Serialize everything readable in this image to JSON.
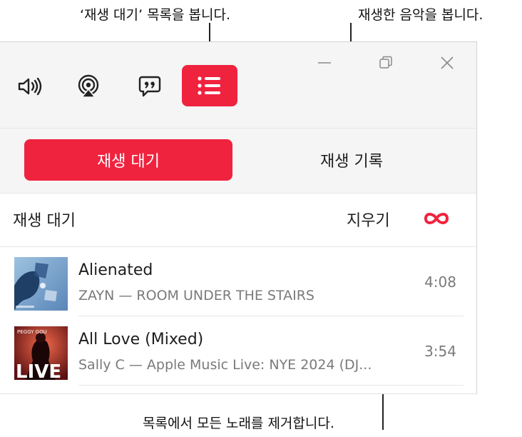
{
  "callouts": {
    "queue": "‘재생 대기’ 목록을 봅니다.",
    "history": "재생한 음악을 봅니다.",
    "clear": "목록에서 모든 노래를 제거합니다."
  },
  "toolbar": {
    "icons": [
      "volume-icon",
      "airplay-icon",
      "lyrics-icon",
      "queue-list-icon"
    ],
    "active_color": "#f0233f",
    "window_controls": [
      "minimize-icon",
      "restore-icon",
      "close-icon"
    ]
  },
  "tabs": {
    "queue_label": "재생 대기",
    "history_label": "재생 기록"
  },
  "list_header": {
    "title": "재생 대기",
    "clear_label": "지우기",
    "autoplay_icon": "infinity-icon"
  },
  "tracks": [
    {
      "title": "Alienated",
      "subtitle": "ZAYN — ROOM UNDER THE STAIRS",
      "duration": "4:08"
    },
    {
      "title": "All Love (Mixed)",
      "subtitle": "Sally C — Apple Music Live: NYE 2024 (DJ...",
      "duration": "3:54",
      "art_text": "LIVE",
      "art_top_text": "PEGGY GOU"
    }
  ]
}
